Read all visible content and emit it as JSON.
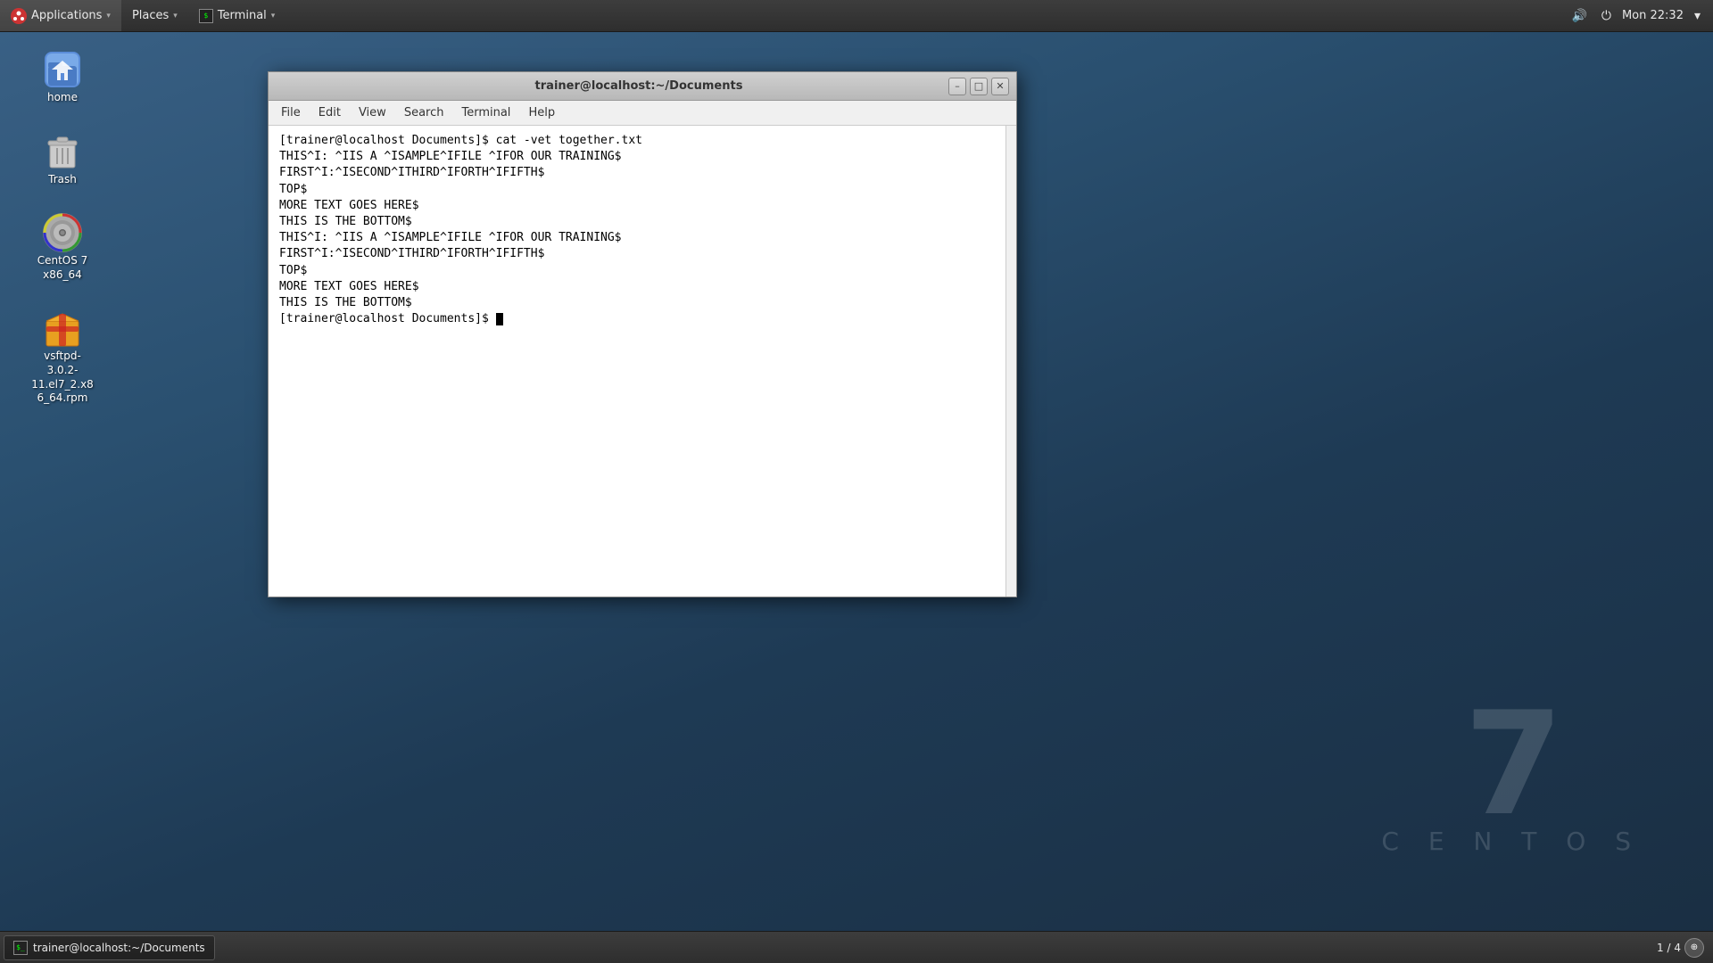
{
  "taskbar_top": {
    "applications_label": "Applications",
    "places_label": "Places",
    "terminal_label": "Terminal",
    "datetime": "Mon 22:32"
  },
  "taskbar_bottom": {
    "terminal_item_label": "trainer@localhost:~/Documents",
    "workspace_label": "1 / 4"
  },
  "desktop_icons": [
    {
      "name": "home",
      "label": "home"
    },
    {
      "name": "trash",
      "label": "Trash"
    },
    {
      "name": "centos-dvd",
      "label": "CentOS 7 x86_64"
    },
    {
      "name": "vsftpd-rpm",
      "label": "vsftpd-3.0.2-11.el7_2.x86_64.rpm"
    }
  ],
  "terminal_window": {
    "title": "trainer@localhost:~/Documents",
    "menu_items": [
      "File",
      "Edit",
      "View",
      "Search",
      "Terminal",
      "Help"
    ],
    "content_lines": [
      "[trainer@localhost Documents]$ cat -vet together.txt",
      "THIS^I: ^IIS A ^ISAMPLE^IFILE ^IFOR OUR TRAINING$",
      "FIRST^I:^ISECOND^ITHIRD^IFORTH^IFIFTH$",
      "TOP$",
      "MORE TEXT GOES HERE$",
      "THIS IS THE BOTTOM$",
      "THIS^I: ^IIS A ^ISAMPLE^IFILE ^IFOR OUR TRAINING$",
      "FIRST^I:^ISECOND^ITHIRD^IFORTH^IFIFTH$",
      "TOP$",
      "MORE TEXT GOES HERE$",
      "THIS IS THE BOTTOM$",
      "[trainer@localhost Documents]$ "
    ],
    "buttons": {
      "minimize": "–",
      "maximize": "□",
      "close": "✕"
    }
  },
  "centos_watermark": {
    "number": "7",
    "text": "C E N T O S"
  }
}
